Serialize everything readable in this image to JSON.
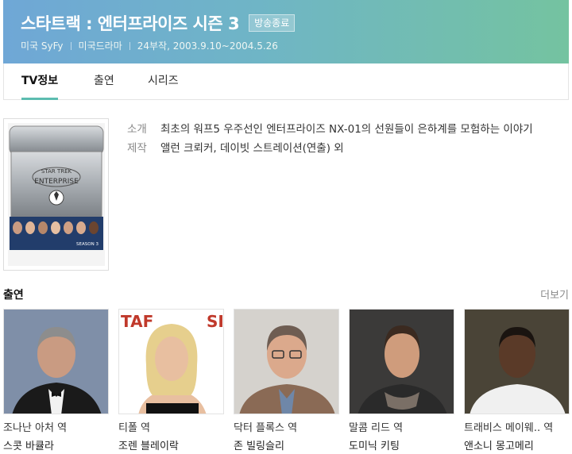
{
  "header": {
    "title": "스타트랙 : 엔터프라이즈 시즌 3",
    "status_badge": "방송종료",
    "meta": [
      "미국 SyFy",
      "미국드라마",
      "24부작, 2003.9.10~2004.5.26"
    ]
  },
  "tabs": [
    {
      "label": "TV정보",
      "active": true
    },
    {
      "label": "출연",
      "active": false
    },
    {
      "label": "시리즈",
      "active": false
    }
  ],
  "poster": {
    "series_text": "SEASON 3"
  },
  "info": {
    "intro_label": "소개",
    "intro_value": "최초의 워프5 우주선인 엔터프라이즈 NX-01의 선원들이 은하계를 모험하는 이야기",
    "credit_label": "제작",
    "credit_value": "앨런 크뢰커, 데이빗 스트레이션(연출) 외"
  },
  "cast_section": {
    "title": "출연",
    "more": "더보기",
    "items": [
      {
        "role": "조나난 아처 역",
        "name": "스콧 바큘라",
        "bg": "#7f8fa8",
        "skin": "#c99b82",
        "hair": "#8d8d8d"
      },
      {
        "role": "티폴 역",
        "name": "조렌 블레이락",
        "bg": "#c8b8a6",
        "skin": "#e8bfa0",
        "hair": "#e6cf8d"
      },
      {
        "role": "닥터 플록스 역",
        "name": "존 빌링슬리",
        "bg": "#d5d2cd",
        "skin": "#dba98c",
        "hair": "#6e5d52"
      },
      {
        "role": "말콤 리드 역",
        "name": "도미닉 키팅",
        "bg": "#3b3a39",
        "skin": "#cf9c7c",
        "hair": "#3b2a20"
      },
      {
        "role": "트래비스 메이웨.. 역",
        "name": "앤소니 몽고메리",
        "bg": "#4a4437",
        "skin": "#5a3a28",
        "hair": "#1a1410"
      }
    ]
  },
  "colors": {
    "accent": "#5cbcb0",
    "header_start": "#6fa7d6",
    "header_end": "#74c3a0"
  }
}
